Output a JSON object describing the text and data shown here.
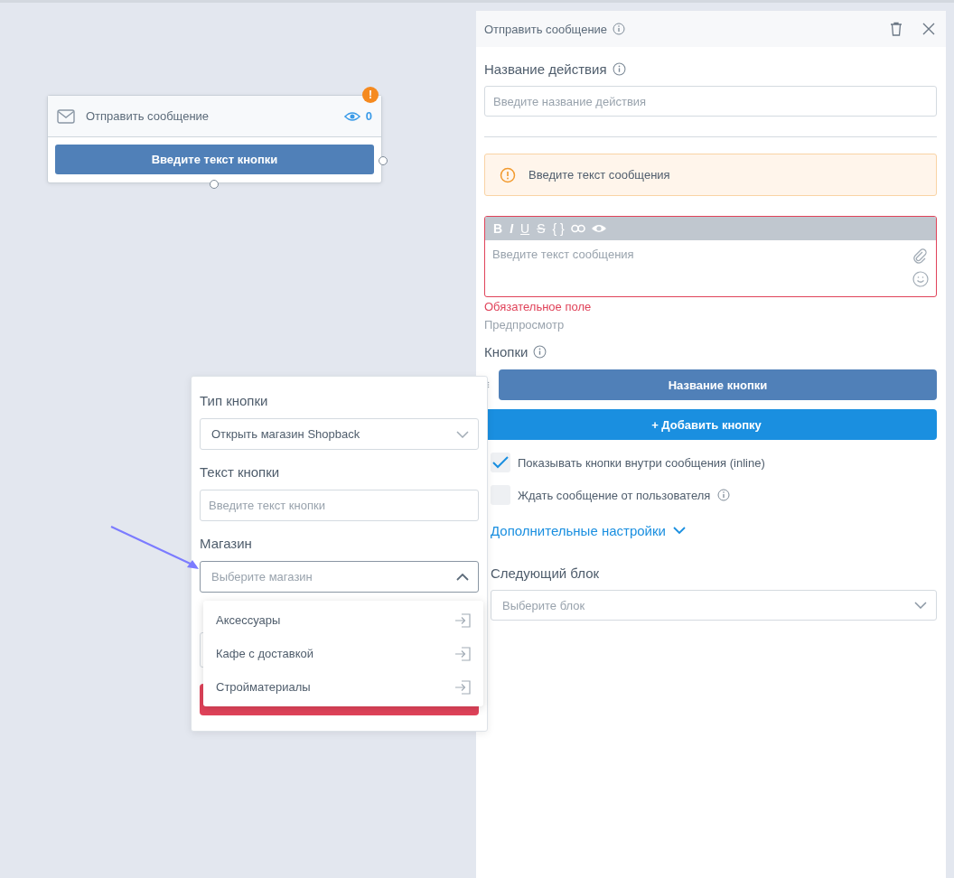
{
  "node": {
    "title": "Отправить сообщение",
    "views": "0",
    "warning": "!",
    "button": "Введите текст кнопки"
  },
  "panel": {
    "title": "Отправить сообщение",
    "action_name": {
      "label": "Название действия",
      "placeholder": "Введите название действия"
    },
    "alert": "Введите текст сообщения",
    "editor": {
      "toolbar": [
        "B",
        "I",
        "U",
        "S",
        "{ }"
      ],
      "placeholder": "Введите текст сообщения",
      "invalid": true,
      "error": "Обязательное поле"
    },
    "preview": "Предпросмотр",
    "buttons_label": "Кнопки",
    "buttons": [
      "Название кнопки"
    ],
    "add_button": "+ Добавить кнопку",
    "options": [
      {
        "label": "Показывать кнопки внутри сообщения (inline)",
        "checked": true,
        "info": false
      },
      {
        "label": "Ждать сообщение от пользователя",
        "checked": false,
        "info": true
      }
    ],
    "advanced": {
      "label": "Дополнительные настройки",
      "expanded": false
    },
    "next_block": {
      "label": "Следующий блок",
      "placeholder": "Выберите блок"
    }
  },
  "button_editor": {
    "type": {
      "label": "Тип кнопки",
      "value": "Открыть магазин Shopback"
    },
    "text": {
      "label": "Текст кнопки",
      "placeholder": "Введите текст кнопки"
    },
    "shop": {
      "label": "Магазин",
      "placeholder": "Выберите магазин",
      "expanded": true,
      "options": [
        "Аксессуары",
        "Кафе с доставкой",
        "Стройматериалы"
      ]
    }
  }
}
